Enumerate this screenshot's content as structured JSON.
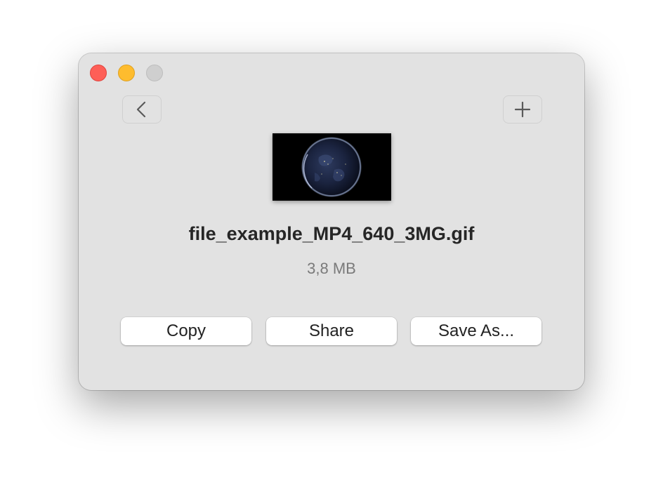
{
  "window": {
    "controls": {
      "close": "close-icon",
      "minimize": "minimize-icon",
      "zoom": "zoom-icon"
    }
  },
  "toolbar": {
    "back_icon": "chevron-left-icon",
    "add_icon": "plus-icon"
  },
  "preview": {
    "thumbnail_icon": "earth-thumbnail"
  },
  "file": {
    "name": "file_example_MP4_640_3MG.gif",
    "size": "3,8 MB"
  },
  "actions": {
    "copy_label": "Copy",
    "share_label": "Share",
    "save_as_label": "Save As..."
  },
  "colors": {
    "window_bg": "#e2e2e2",
    "close": "#fe5f57",
    "minimize": "#febc2e",
    "zoom_inactive": "#cfcfcf"
  }
}
